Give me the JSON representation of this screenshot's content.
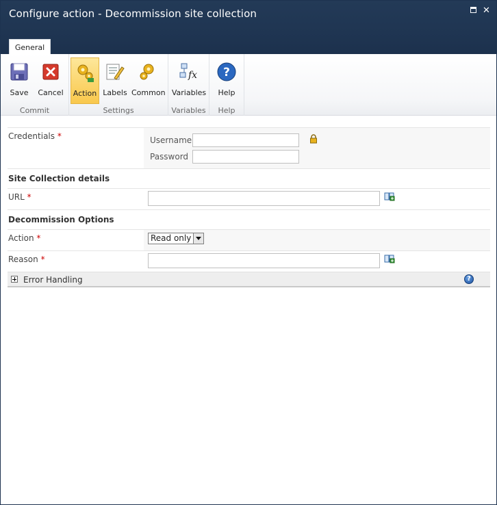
{
  "window": {
    "title": "Configure action - Decommission site collection"
  },
  "ribbon": {
    "tab": "General",
    "groups": {
      "commit": "Commit",
      "settings": "Settings",
      "variables": "Variables",
      "help": "Help"
    },
    "buttons": {
      "save": "Save",
      "cancel": "Cancel",
      "action": "Action",
      "labels": "Labels",
      "common": "Common",
      "variables": "Variables",
      "help": "Help"
    }
  },
  "form": {
    "credentials": {
      "label": "Credentials",
      "required": "*",
      "username_label": "Username",
      "password_label": "Password",
      "username_value": "",
      "password_value": ""
    },
    "site_section": "Site Collection details",
    "url": {
      "label": "URL",
      "required": "*",
      "value": ""
    },
    "decommission_section": "Decommission Options",
    "action": {
      "label": "Action",
      "required": "*",
      "selected": "Read only"
    },
    "reason": {
      "label": "Reason",
      "required": "*",
      "value": ""
    },
    "error_handling": "Error Handling"
  }
}
